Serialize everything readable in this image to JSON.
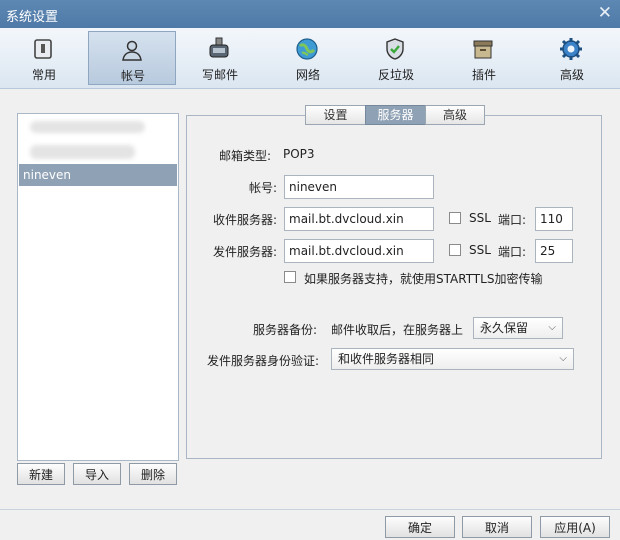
{
  "window": {
    "title": "系统设置",
    "close_glyph": "✕"
  },
  "toolbar": {
    "items": [
      {
        "label": "常用",
        "icon": "general-icon"
      },
      {
        "label": "帐号",
        "icon": "account-icon"
      },
      {
        "label": "写邮件",
        "icon": "compose-icon"
      },
      {
        "label": "网络",
        "icon": "network-icon"
      },
      {
        "label": "反垃圾",
        "icon": "antispam-icon"
      },
      {
        "label": "插件",
        "icon": "plugin-icon"
      },
      {
        "label": "高级",
        "icon": "advanced-icon"
      }
    ],
    "active": "帐号"
  },
  "accounts": {
    "selected": "nineven",
    "buttons": {
      "new": "新建",
      "import": "导入",
      "delete": "删除"
    }
  },
  "tabs": [
    {
      "label": "设置"
    },
    {
      "label": "服务器"
    },
    {
      "label": "高级"
    }
  ],
  "server": {
    "mailbox_type_label": "邮箱类型:",
    "mailbox_type_value": "POP3",
    "account_label": "帐号:",
    "account_value": "nineven",
    "incoming_label": "收件服务器:",
    "incoming_value": "mail.bt.dvcloud.xin",
    "incoming_ssl_label": "SSL",
    "incoming_port_label": "端口:",
    "incoming_port": "110",
    "outgoing_label": "发件服务器:",
    "outgoing_value": "mail.bt.dvcloud.xin",
    "outgoing_ssl_label": "SSL",
    "outgoing_port_label": "端口:",
    "outgoing_port": "25",
    "starttls_label": "如果服务器支持，就使用STARTTLS加密传输",
    "backup_label": "服务器备份:",
    "backup_text": "邮件收取后，在服务器上",
    "backup_option": "永久保留",
    "auth_label": "发件服务器身份验证:",
    "auth_option": "和收件服务器相同"
  },
  "footer": {
    "ok": "确定",
    "cancel": "取消",
    "apply": "应用(A)"
  },
  "colors": {
    "title_bar": "#5580ad",
    "selected_row": "#8fa1b4",
    "toolbar_bg": "#e4ecf4"
  }
}
